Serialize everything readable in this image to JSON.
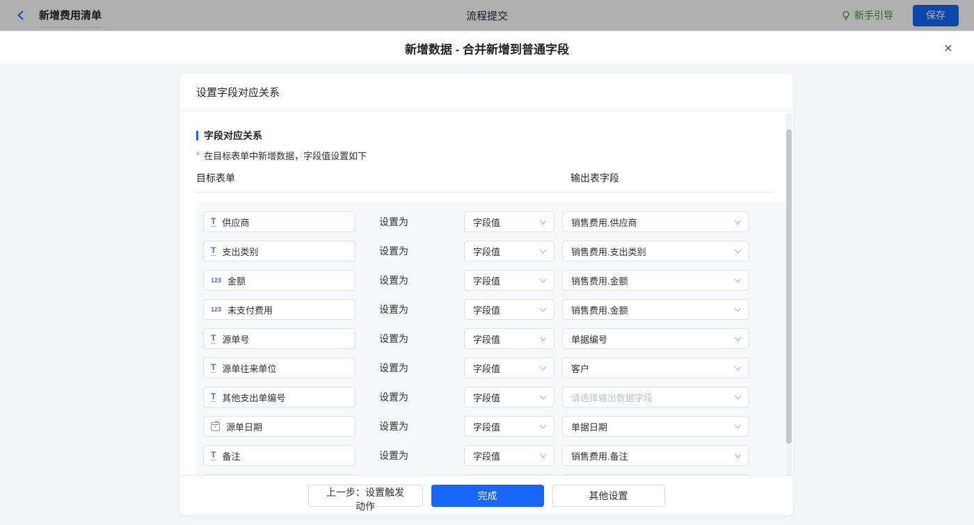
{
  "topbar": {
    "back_title": "新增费用清单",
    "center_title": "流程提交",
    "guide_label": "新手引导",
    "save_label": "保存"
  },
  "modal": {
    "title": "新增数据 - 合并新增到普通字段",
    "close_glyph": "✕"
  },
  "card": {
    "header": "设置字段对应关系",
    "section_title": "字段对应关系",
    "note_star": "*",
    "note": "在目标表单中新增数据，字段值设置如下",
    "col_target": "目标表单",
    "col_output": "输出表字段",
    "set_as_label": "设置为",
    "icon_glyphs": {
      "text": "T",
      "number": "123",
      "date": "7"
    },
    "rows": [
      {
        "icon": "text",
        "field": "供应商",
        "mode": "字段值",
        "output": "销售费用.供应商",
        "placeholder": false
      },
      {
        "icon": "text",
        "field": "支出类别",
        "mode": "字段值",
        "output": "销售费用.支出类别",
        "placeholder": false
      },
      {
        "icon": "number",
        "field": "金额",
        "mode": "字段值",
        "output": "销售费用.金额",
        "placeholder": false
      },
      {
        "icon": "number",
        "field": "未支付费用",
        "mode": "字段值",
        "output": "销售费用.金额",
        "placeholder": false
      },
      {
        "icon": "text",
        "field": "源单号",
        "mode": "字段值",
        "output": "单据编号",
        "placeholder": false
      },
      {
        "icon": "text",
        "field": "源单往来单位",
        "mode": "字段值",
        "output": "客户",
        "placeholder": false
      },
      {
        "icon": "text",
        "field": "其他支出单编号",
        "mode": "字段值",
        "output": "请选择输出数据字段",
        "placeholder": true
      },
      {
        "icon": "date",
        "field": "源单日期",
        "mode": "字段值",
        "output": "单据日期",
        "placeholder": false
      },
      {
        "icon": "text",
        "field": "备注",
        "mode": "字段值",
        "output": "销售费用.备注",
        "placeholder": false
      },
      {
        "icon": "",
        "field": "",
        "mode": "",
        "output": "",
        "placeholder": false
      }
    ],
    "footer": {
      "prev_label": "上一步：设置触发动作",
      "done_label": "完成",
      "other_label": "其他设置"
    }
  },
  "colors": {
    "accent_blue": "#1766f5",
    "guide_green": "#2ea121",
    "field_icon_blue": "#4a6bef",
    "required_red": "#f56c6c"
  }
}
